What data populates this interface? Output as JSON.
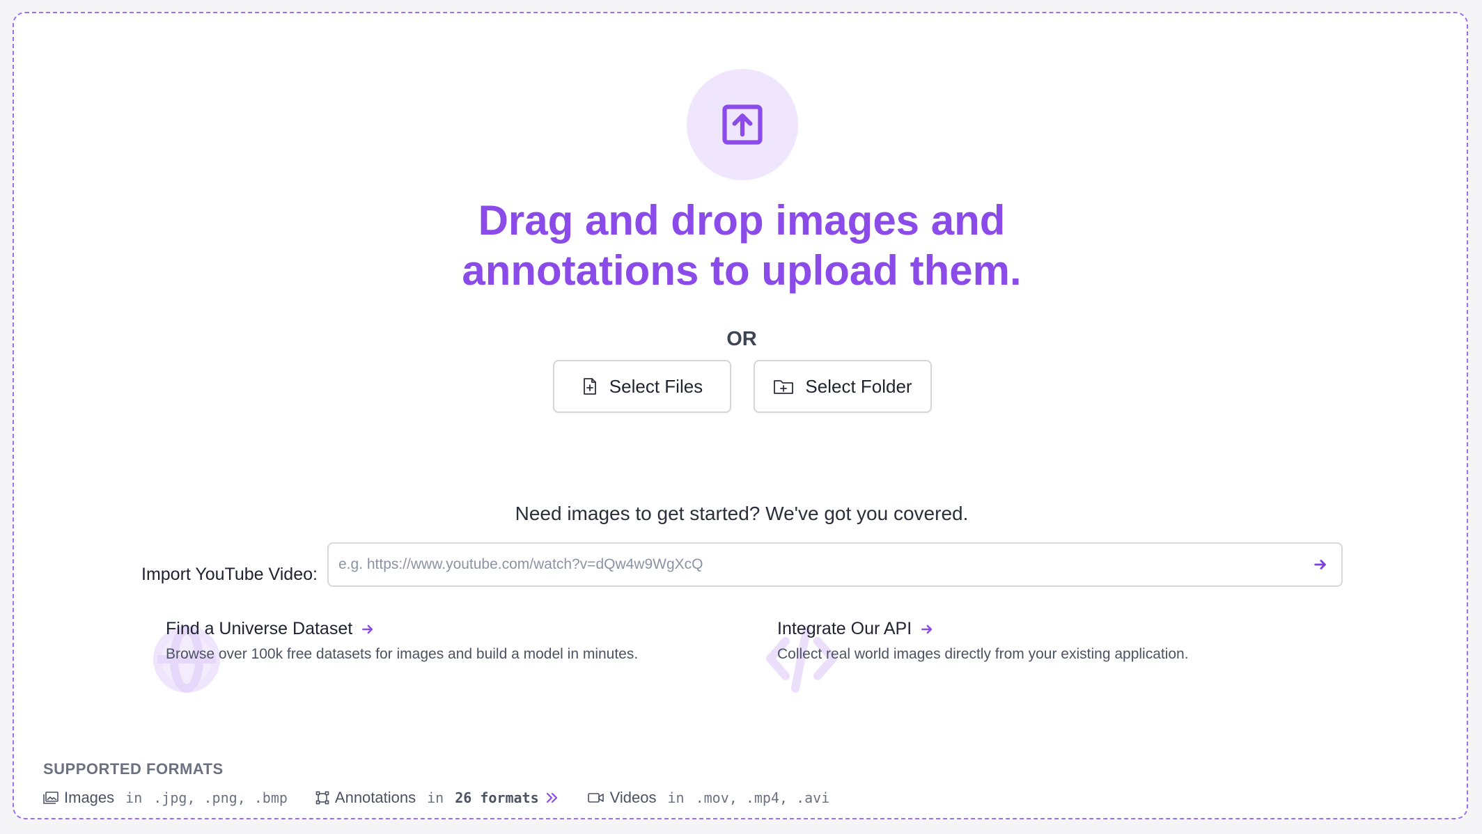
{
  "headline": {
    "line1": "Drag and drop images and",
    "line2": "annotations to upload them."
  },
  "or_label": "OR",
  "buttons": {
    "select_files": "Select Files",
    "select_folder": "Select Folder"
  },
  "need_images": "Need images to get started? We've got you covered.",
  "youtube": {
    "label": "Import YouTube Video:",
    "placeholder": "e.g. https://www.youtube.com/watch?v=dQw4w9WgXcQ",
    "value": ""
  },
  "cards": {
    "universe": {
      "title": "Find a Universe Dataset",
      "description": "Browse over 100k free datasets for images and build a model in minutes."
    },
    "api": {
      "title": "Integrate Our API",
      "description": "Collect real world images directly from your existing application."
    }
  },
  "supported_formats": {
    "title": "SUPPORTED FORMATS",
    "images": {
      "label": "Images",
      "in": "in",
      "list": ".jpg, .png, .bmp"
    },
    "annotations": {
      "label": "Annotations",
      "in": "in",
      "count": "26 formats"
    },
    "videos": {
      "label": "Videos",
      "in": "in",
      "list": ".mov, .mp4, .avi"
    }
  },
  "icons": {
    "upload": "upload-arrow-icon",
    "file_plus": "file-plus-icon",
    "folder_plus": "folder-plus-icon",
    "arrow_right": "arrow-right-icon",
    "globe": "globe-icon",
    "code": "code-icon",
    "image": "image-icon",
    "bounding_box": "bounding-box-icon",
    "video": "video-camera-icon",
    "double_chevron": "double-chevron-right-icon"
  },
  "colors": {
    "accent": "#8a4be8",
    "accent_light": "#efe6fd",
    "border_dashed": "#9b6ff0"
  }
}
